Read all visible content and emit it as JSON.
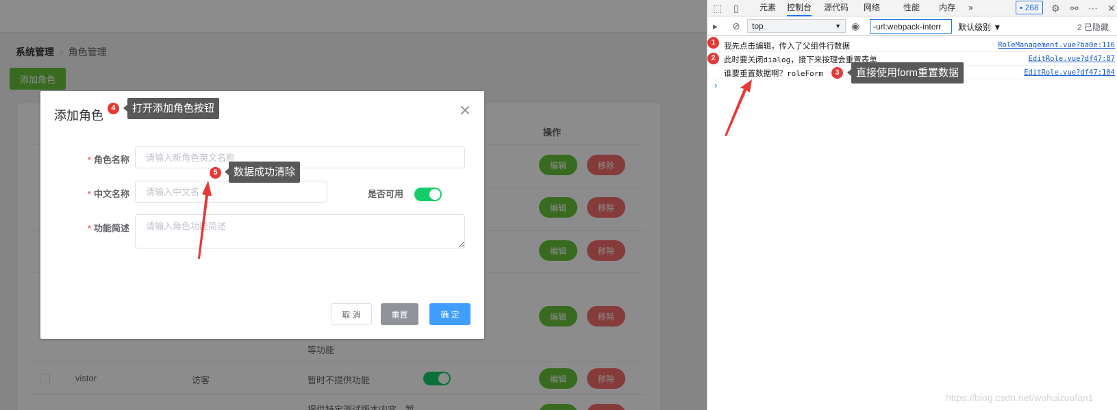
{
  "app": {
    "breadcrumb": {
      "root": "系统管理",
      "separator": "›",
      "current": "角色管理"
    },
    "add_role_button": "添加角色",
    "table": {
      "operations_header": "操作",
      "edit_label": "编辑",
      "delete_label": "移除",
      "rows": [
        {
          "name": "vistor",
          "cn_name": "访客",
          "desc": "暂时不提供功能"
        }
      ],
      "partial_desc_1": "等功能",
      "partial_desc_2": "提供特定测试版本内容，暂"
    }
  },
  "dialog": {
    "title": "添加角色",
    "fields": {
      "role_name": {
        "label": "角色名称",
        "placeholder": "请输入新角色英文名称"
      },
      "cn_name": {
        "label": "中文名称",
        "placeholder": "请输入中文名"
      },
      "enabled": {
        "label": "是否可用",
        "value": true
      },
      "description": {
        "label": "功能简述",
        "placeholder": "请输入角色功能简述"
      }
    },
    "buttons": {
      "cancel": "取 消",
      "reset": "重置",
      "confirm": "确 定"
    }
  },
  "annotations": [
    {
      "num": "4",
      "text": "打开添加角色按钮"
    },
    {
      "num": "5",
      "text": "数据成功清除"
    },
    {
      "num": "3",
      "text": "直接使用form重置数据"
    },
    {
      "num": "1"
    },
    {
      "num": "2"
    }
  ],
  "devtools": {
    "tabs": [
      "元素",
      "控制台",
      "源代码",
      "网络",
      "性能",
      "内存"
    ],
    "active_tab": "控制台",
    "more": "»",
    "issues_count": "268",
    "context": "top",
    "filter": "-url:webpack-interr",
    "levels": "默认级别 ▼",
    "hidden": "2 已隐藏",
    "logs": [
      {
        "msg": "我先点击编辑，传入了父组件行数据",
        "extra": "",
        "src": "RoleManagement.vue?ba0e:116"
      },
      {
        "msg": "此时要关闭",
        "extra": "dialog",
        "msg2": "，接下来按理会重置表单",
        "src": "EditRole.vue?df47:87"
      },
      {
        "msg": "谁要重置数据啊？",
        "extra": "roleForm",
        "src": "EditRole.vue?df47:104"
      }
    ],
    "prompt": "›"
  },
  "watermark": "https://blog.csdn.net/wohuizuofan1",
  "colors": {
    "success": "#67c23a",
    "danger": "#f56c6c",
    "primary": "#409eff",
    "info": "#909399",
    "switch_on": "#13ce66",
    "annotation_red": "#e53935"
  }
}
